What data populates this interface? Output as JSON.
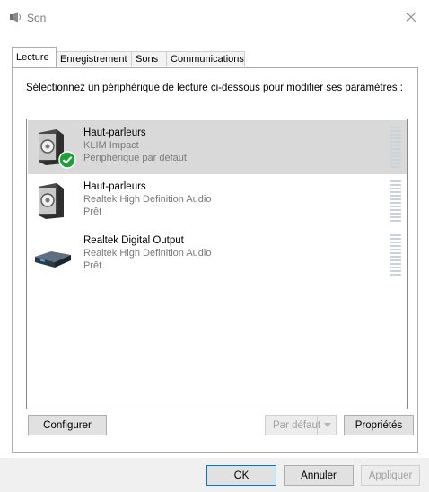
{
  "window": {
    "title": "Son"
  },
  "tabs": [
    {
      "label": "Lecture",
      "active": true
    },
    {
      "label": "Enregistrement",
      "active": false
    },
    {
      "label": "Sons",
      "active": false
    },
    {
      "label": "Communications",
      "active": false
    }
  ],
  "instruction": "Sélectionnez un périphérique de lecture ci-dessous pour modifier ses paramètres :",
  "devices": [
    {
      "name": "Haut-parleurs",
      "line1": "KLIM Impact",
      "line2": "Périphérique par défaut",
      "icon": "speaker-icon",
      "selected": true,
      "is_default": true
    },
    {
      "name": "Haut-parleurs",
      "line1": "Realtek High Definition Audio",
      "line2": "Prêt",
      "icon": "speaker-icon",
      "selected": false,
      "is_default": false
    },
    {
      "name": "Realtek Digital Output",
      "line1": "Realtek High Definition Audio",
      "line2": "Prêt",
      "icon": "digital-output-icon",
      "selected": false,
      "is_default": false
    }
  ],
  "panel_buttons": {
    "configure": "Configurer",
    "set_default": "Par défaut",
    "properties": "Propriétés"
  },
  "dialog_buttons": {
    "ok": "OK",
    "cancel": "Annuler",
    "apply": "Appliquer"
  },
  "colors": {
    "selected_row": "#d9d9d9",
    "default_check": "#1f9e3a",
    "secondary_text": "#7a7a7a"
  }
}
